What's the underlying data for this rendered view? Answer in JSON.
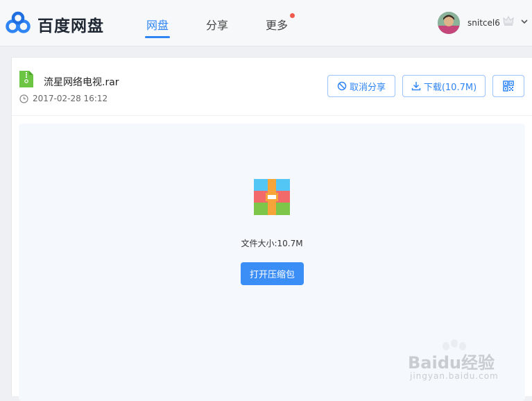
{
  "header": {
    "logo_text": "百度网盘",
    "nav": [
      {
        "label": "网盘",
        "active": true
      },
      {
        "label": "分享",
        "active": false
      },
      {
        "label": "更多",
        "active": false,
        "has_badge": true
      }
    ],
    "username": "snitcel6"
  },
  "file": {
    "name": "流星网络电视.rar",
    "date": "2017-02-28 16:12",
    "icon": "zip-file-icon"
  },
  "actions": {
    "cancel_share": "取消分享",
    "download": "下载(10.7M)",
    "qr_icon": "qrcode-icon"
  },
  "preview": {
    "size_text": "文件大小:10.7M",
    "open_button": "打开压缩包"
  },
  "watermark": {
    "text": "Baidu经验",
    "sub": "jingyan.baidu.com"
  },
  "colors": {
    "accent": "#2f85f4",
    "badge": "#f0594b",
    "file_icon": "#6cc644"
  }
}
